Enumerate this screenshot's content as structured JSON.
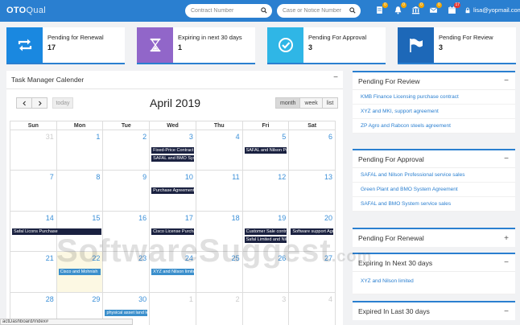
{
  "app": {
    "logo_main": "OTO",
    "logo_sub": "Qual"
  },
  "search": {
    "contract_placeholder": "Contract Number",
    "case_placeholder": "Case or Notice Number"
  },
  "header_icons": [
    {
      "icon": "document-icon",
      "badge": "0"
    },
    {
      "icon": "bell-icon",
      "badge": "0"
    },
    {
      "icon": "bank-icon",
      "badge": "0"
    },
    {
      "icon": "envelope-icon",
      "badge": "0"
    },
    {
      "icon": "calendar-icon",
      "badge": "17"
    }
  ],
  "user": {
    "email": "lisa@yopmail.com"
  },
  "cards": [
    {
      "label": "Pending for Renewal",
      "value": "17",
      "color": "#1a88e0",
      "icon": "renew-icon"
    },
    {
      "label": "Expiring in next 30 days",
      "value": "1",
      "color": "#9166c9",
      "icon": "hourglass-icon"
    },
    {
      "label": "Pending For Approval",
      "value": "3",
      "color": "#2fb6e6",
      "icon": "check-circle-icon"
    },
    {
      "label": "Pending For Review",
      "value": "3",
      "color": "#1d68b8",
      "icon": "flags-icon"
    }
  ],
  "calendar": {
    "title": "Task Manager Calender",
    "today_label": "today",
    "month_title": "April 2019",
    "views": [
      "month",
      "week",
      "list"
    ],
    "days_of_week": [
      "Sun",
      "Mon",
      "Tue",
      "Wed",
      "Thu",
      "Fri",
      "Sat"
    ],
    "weeks": [
      [
        {
          "n": "31",
          "other": true,
          "events": []
        },
        {
          "n": "1",
          "events": []
        },
        {
          "n": "2",
          "events": []
        },
        {
          "n": "3",
          "events": [
            {
              "t": "Fixed-Price Contract"
            },
            {
              "t": "SAFAL and BMO Syste"
            }
          ]
        },
        {
          "n": "4",
          "events": []
        },
        {
          "n": "5",
          "events": [
            {
              "t": "SAFAL and Nilson Prof"
            }
          ]
        },
        {
          "n": "6",
          "events": []
        }
      ],
      [
        {
          "n": "7",
          "events": []
        },
        {
          "n": "8",
          "events": []
        },
        {
          "n": "9",
          "events": []
        },
        {
          "n": "10",
          "events": [
            {
              "t": "Purchase Agreement"
            }
          ]
        },
        {
          "n": "11",
          "events": []
        },
        {
          "n": "12",
          "events": []
        },
        {
          "n": "13",
          "events": []
        }
      ],
      [
        {
          "n": "14",
          "events": [
            {
              "t": "Safal Licons Purchase",
              "span2": true
            }
          ]
        },
        {
          "n": "15",
          "events": []
        },
        {
          "n": "16",
          "events": []
        },
        {
          "n": "17",
          "events": [
            {
              "t": "Cisco License Purchas"
            }
          ]
        },
        {
          "n": "18",
          "events": []
        },
        {
          "n": "19",
          "events": [
            {
              "t": "Customer Sale contrac"
            },
            {
              "t": "Safal Limited and Nils"
            }
          ]
        },
        {
          "n": "20",
          "events": [
            {
              "t": "Software support Agre"
            }
          ]
        }
      ],
      [
        {
          "n": "21",
          "events": []
        },
        {
          "n": "22",
          "today": true,
          "events": [
            {
              "t": "Cisco and Mohnish",
              "blue": true
            }
          ]
        },
        {
          "n": "23",
          "events": []
        },
        {
          "n": "24",
          "events": [
            {
              "t": "XYZ and Nilson limited",
              "blue": true
            }
          ]
        },
        {
          "n": "25",
          "events": []
        },
        {
          "n": "26",
          "events": []
        },
        {
          "n": "27",
          "events": []
        }
      ],
      [
        {
          "n": "28",
          "events": []
        },
        {
          "n": "29",
          "events": []
        },
        {
          "n": "30",
          "events": [
            {
              "t": "physical asset land lea",
              "blue": true
            }
          ]
        },
        {
          "n": "1",
          "other": true,
          "events": []
        },
        {
          "n": "2",
          "other": true,
          "events": []
        },
        {
          "n": "3",
          "other": true,
          "events": []
        },
        {
          "n": "4",
          "other": true,
          "events": []
        }
      ]
    ]
  },
  "right_panels": [
    {
      "title": "Pending For Review",
      "toggle": "−",
      "items": [
        "KMB Finance Licensing purchase contract",
        "XYZ and MKI, support agreement",
        "ZP Agro and Rabcon steels agreement"
      ]
    },
    {
      "title": "Pending For Approval",
      "toggle": "−",
      "items": [
        "SAFAL and Nilson Professional service sales",
        "Green Plant and BMO System Agreement",
        "SAFAL and BMO System service sales"
      ]
    },
    {
      "title": "Pending For Renewal",
      "toggle": "+",
      "items": []
    },
    {
      "title": "Expiring In Next 30 days",
      "toggle": "−",
      "items": [
        "XYZ and Nilson limited"
      ]
    },
    {
      "title": "Expired In Last 30 days",
      "toggle": "−",
      "items": []
    }
  ],
  "watermark": {
    "main": "SoftwareSuggest",
    "suffix": ".com"
  },
  "status_url": "actDashboard/Index#"
}
